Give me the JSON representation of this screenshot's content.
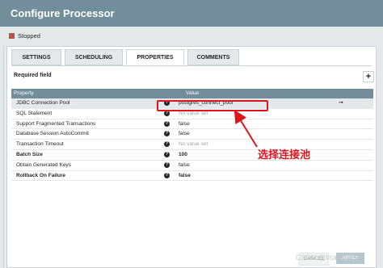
{
  "dialog": {
    "title": "Configure Processor"
  },
  "status": {
    "label": "Stopped",
    "color": "#ba554a"
  },
  "tabs": [
    {
      "label": "SETTINGS",
      "active": false
    },
    {
      "label": "SCHEDULING",
      "active": false
    },
    {
      "label": "PROPERTIES",
      "active": true
    },
    {
      "label": "COMMENTS",
      "active": false
    }
  ],
  "properties_panel": {
    "required_label": "Required field",
    "add_button_label": "+",
    "columns": {
      "property": "Property",
      "value": "Value"
    },
    "rows": [
      {
        "name": "JDBC Connection Pool",
        "value": "postgres_connect_pool",
        "required": true,
        "empty": false,
        "selected": true
      },
      {
        "name": "SQL Statement",
        "value": "No value set",
        "required": false,
        "empty": true
      },
      {
        "name": "Support Fragmented Transactions",
        "value": "false",
        "required": false,
        "empty": false
      },
      {
        "name": "Database Session AutoCommit",
        "value": "false",
        "required": false,
        "empty": false
      },
      {
        "name": "Transaction Timeout",
        "value": "No value set",
        "required": false,
        "empty": true
      },
      {
        "name": "Batch Size",
        "value": "100",
        "required": true,
        "empty": false
      },
      {
        "name": "Obtain Generated Keys",
        "value": "false",
        "required": false,
        "empty": false
      },
      {
        "name": "Rollback On Failure",
        "value": "false",
        "required": true,
        "empty": false
      }
    ]
  },
  "annotation": {
    "text": "选择连接池",
    "color": "#e0121b"
  },
  "footer": {
    "cancel_label": "CANCEL",
    "apply_label": "APPLY",
    "watermark": "CSDN @lisacumt"
  }
}
